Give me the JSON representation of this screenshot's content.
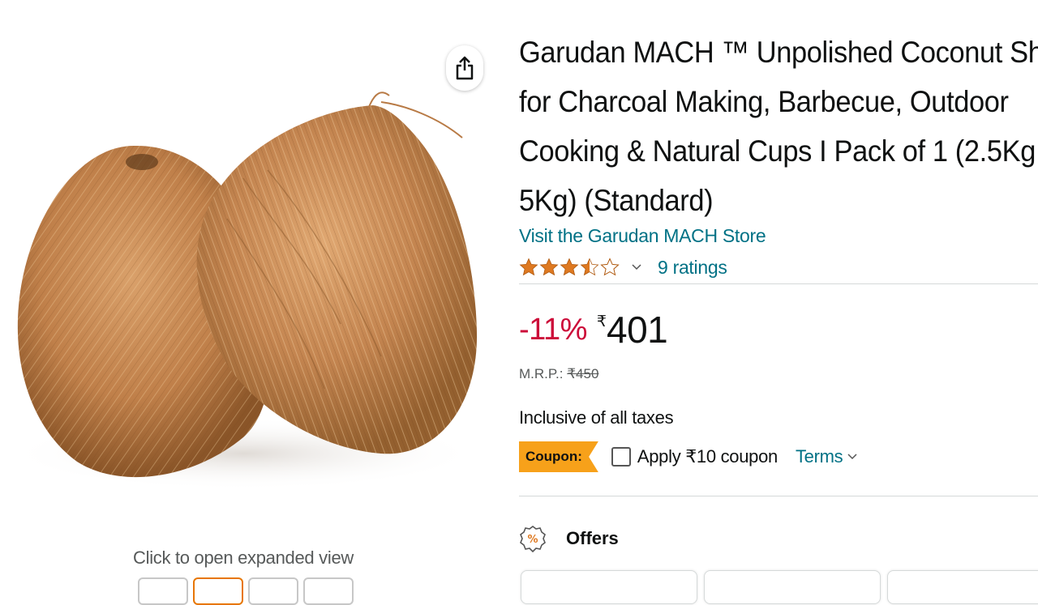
{
  "gallery": {
    "share_icon": "share-icon",
    "expand_hint": "Click to open expanded view",
    "thumbnail_count": 4,
    "active_thumbnail": 2
  },
  "product": {
    "title_lines": [
      "Garudan MACH ™ Unpolished Coconut Sh",
      "for Charcoal Making, Barbecue, Outdoor",
      "Cooking & Natural Cups I Pack of 1 (2.5Kg",
      "5Kg) (Standard)"
    ],
    "store_link": "Visit the Garudan MACH Store",
    "rating_stars": 3.5,
    "ratings_count": "9 ratings",
    "discount": "-11%",
    "currency_symbol": "₹",
    "price": "401",
    "mrp_label": "M.R.P.:",
    "mrp_value": "₹450",
    "tax_note": "Inclusive of all taxes",
    "coupon_badge": "Coupon:",
    "coupon_text": "Apply ₹10 coupon",
    "terms_label": "Terms",
    "offers_title": "Offers",
    "offers_icon": "percent-badge-icon"
  },
  "colors": {
    "link": "#007185",
    "discount": "#cc0c39",
    "star": "#de7921",
    "coupon_badge": "#f7a11a",
    "active_thumbnail_border": "#e77600"
  }
}
